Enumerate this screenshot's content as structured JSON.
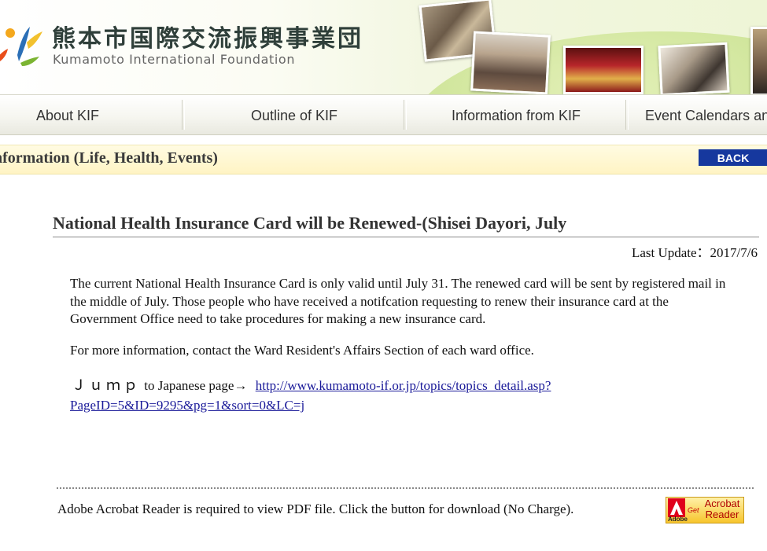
{
  "header": {
    "logo_jp": "熊本市国際交流振興事業団",
    "logo_en": "Kumamoto International Foundation"
  },
  "nav": {
    "items": [
      {
        "label": "About KIF"
      },
      {
        "label": "Outline of  KIF"
      },
      {
        "label": "Information from KIF"
      },
      {
        "label": "Event Calendars an"
      }
    ]
  },
  "section": {
    "title": "nformation (Life, Health, Events)",
    "back_label": "BACK"
  },
  "article": {
    "title": "National Health Insurance Card will be Renewed-(Shisei Dayori, July",
    "last_update": "Last Update：2017/7/6",
    "paragraph1": "The current National Health Insurance Card is only valid until July 31. The renewed card will be sent by registered mail in the middle of July. Those people who have received a notifcation requesting to renew their insurance card at the Government Office need to take procedures for making a new insurance card.",
    "paragraph2": "For more information, contact the Ward Resident's  Affairs Section of each ward office.",
    "jump_word": "Ｊｕｍｐ",
    "jump_text": "to Japanese page→",
    "jump_link": "http://www.kumamoto-if.or.jp/topics/topics_detail.asp?PageID=5&ID=9295&pg=1&sort=0&LC=j"
  },
  "footer": {
    "text": "Adobe Acrobat Reader is required to view PDF file. Click the button for download (No Charge).",
    "acrobat_adobe": "Adobe",
    "acrobat_get": "Get",
    "acrobat_name": "Acrobat Reader"
  },
  "colors": {
    "back_button": "#16389e",
    "link": "#1a1a99",
    "section_bar": "#fff4c4"
  }
}
